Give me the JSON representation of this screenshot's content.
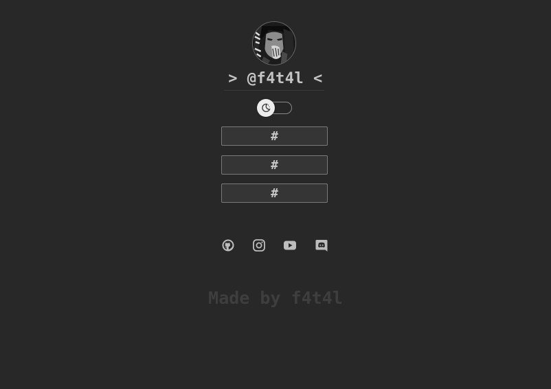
{
  "profile": {
    "avatar_alt": "",
    "username": "> @f4t4l <"
  },
  "theme_toggle": {
    "icon": "moon-icon",
    "state": "dark"
  },
  "links": [
    {
      "label": "#"
    },
    {
      "label": "#"
    },
    {
      "label": "#"
    }
  ],
  "socials": [
    {
      "icon": "github-icon"
    },
    {
      "icon": "instagram-icon"
    },
    {
      "icon": "youtube-icon"
    },
    {
      "icon": "discord-icon"
    }
  ],
  "footer": {
    "text": "Made by f4t4l"
  },
  "colors": {
    "background": "#282828",
    "button_bg": "#353535",
    "button_border": "#7a7a7a",
    "text": "#c4c4c4",
    "footer_text": "#3e3e3e"
  }
}
